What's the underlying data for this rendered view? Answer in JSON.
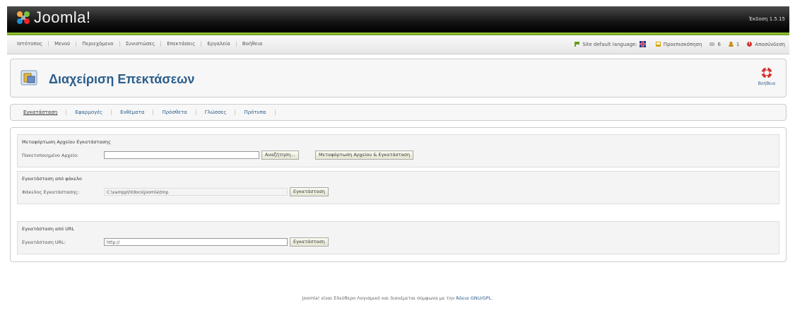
{
  "header": {
    "logo_text": "Joomla!",
    "version": "Έκδοση 1.5.15"
  },
  "menu": {
    "items": [
      "Ιστότοπος",
      "Μενού",
      "Περιεχόμενο",
      "Συνιστώσες",
      "Επεκτάσεις",
      "Εργαλεία",
      "Βοήθεια"
    ]
  },
  "status": {
    "language_label": "Site default language:",
    "preview_label": "Προεπισκόπηση",
    "messages_count": "6",
    "users_count": "1",
    "logout_label": "Αποσύνδεση"
  },
  "toolbar": {
    "page_title": "Διαχείριση Επεκτάσεων",
    "help_label": "Βοήθεια"
  },
  "tabs": [
    "Εγκατάσταση",
    "Εφαρμογές",
    "Ενθέματα",
    "Πρόσθετα",
    "Γλώσσες",
    "Πρότυπα"
  ],
  "upload": {
    "legend": "Μεταφόρτωση Αρχείου Εγκατάστασης",
    "label": "Πακετοποιημένο Αρχείο:",
    "file_value": "",
    "browse_label": "Αναζήτηση...",
    "submit_label": "Μεταφόρτωση Αρχείου & Εγκατάσταση"
  },
  "directory": {
    "legend": "Εγκατάσταση από φάκελο",
    "label": "Φάκελος Εγκατάστασης:",
    "value": "C:\\xampp\\htdocs\\joomla\\tmp",
    "button_label": "Εγκατάσταση"
  },
  "url": {
    "legend": "Εγκατάσταση από URL",
    "label": "Εγκατάσταση URL:",
    "value": "http://",
    "button_label": "Εγκατάσταση"
  },
  "footer": {
    "text": "Joomla! είναι Ελεύθερο Λογισμικό και διανέμεται σύμφωνα με την",
    "link": "Άδεια GNU/GPL."
  }
}
